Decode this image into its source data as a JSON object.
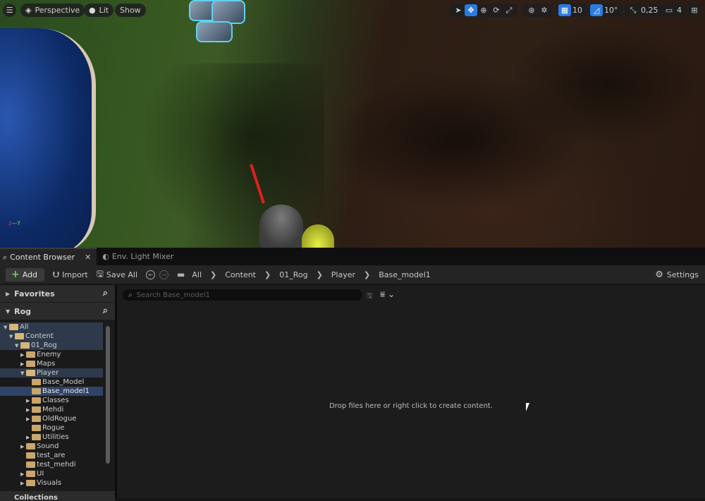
{
  "viewport": {
    "menu_icon": "hamburger-icon",
    "perspective_label": "Perspective",
    "lit_label": "Lit",
    "show_label": "Show",
    "grid_snap_value": "10",
    "rotation_snap_value": "10°",
    "scale_snap_value": "0,25",
    "camera_speed_value": "4"
  },
  "tabs": [
    {
      "label": "Content Browser",
      "active": true
    },
    {
      "label": "Env. Light Mixer",
      "active": false
    }
  ],
  "toolbar": {
    "add_label": "Add",
    "import_label": "Import",
    "save_all_label": "Save All",
    "breadcrumb": [
      "All",
      "Content",
      "01_Rog",
      "Player",
      "Base_model1"
    ],
    "settings_label": "Settings"
  },
  "left_panel": {
    "favorites_label": "Favorites",
    "project_label": "Rog",
    "collections_label": "Collections",
    "tree": [
      {
        "label": "All",
        "indent": 0,
        "arrow": "▼",
        "open": true,
        "state": "hl"
      },
      {
        "label": "Content",
        "indent": 1,
        "arrow": "▼",
        "open": true,
        "state": "hl"
      },
      {
        "label": "01_Rog",
        "indent": 2,
        "arrow": "▼",
        "open": true,
        "state": "hl"
      },
      {
        "label": "Enemy",
        "indent": 3,
        "arrow": "▶",
        "open": false,
        "state": ""
      },
      {
        "label": "Maps",
        "indent": 3,
        "arrow": "▶",
        "open": false,
        "state": ""
      },
      {
        "label": "Player",
        "indent": 3,
        "arrow": "▼",
        "open": true,
        "state": "hl"
      },
      {
        "label": "Base_Model",
        "indent": 4,
        "arrow": "",
        "open": false,
        "state": ""
      },
      {
        "label": "Base_model1",
        "indent": 4,
        "arrow": "",
        "open": false,
        "state": "sel"
      },
      {
        "label": "Classes",
        "indent": 4,
        "arrow": "▶",
        "open": false,
        "state": ""
      },
      {
        "label": "Mehdi",
        "indent": 4,
        "arrow": "▶",
        "open": false,
        "state": ""
      },
      {
        "label": "OldRogue",
        "indent": 4,
        "arrow": "▶",
        "open": false,
        "state": ""
      },
      {
        "label": "Rogue",
        "indent": 4,
        "arrow": "",
        "open": false,
        "state": ""
      },
      {
        "label": "Utilities",
        "indent": 4,
        "arrow": "▶",
        "open": false,
        "state": ""
      },
      {
        "label": "Sound",
        "indent": 3,
        "arrow": "▶",
        "open": false,
        "state": ""
      },
      {
        "label": "test_are",
        "indent": 3,
        "arrow": "",
        "open": false,
        "state": ""
      },
      {
        "label": "test_mehdi",
        "indent": 3,
        "arrow": "",
        "open": false,
        "state": ""
      },
      {
        "label": "UI",
        "indent": 3,
        "arrow": "▶",
        "open": false,
        "state": ""
      },
      {
        "label": "Visuals",
        "indent": 3,
        "arrow": "▶",
        "open": false,
        "state": ""
      }
    ]
  },
  "main_panel": {
    "search_placeholder": "Search Base_model1",
    "empty_message": "Drop files here or right click to create content."
  },
  "colors": {
    "accent": "#2a7be0",
    "selection": "#2f4366",
    "folder": "#c9a66b",
    "add_plus": "#6fd35c"
  }
}
